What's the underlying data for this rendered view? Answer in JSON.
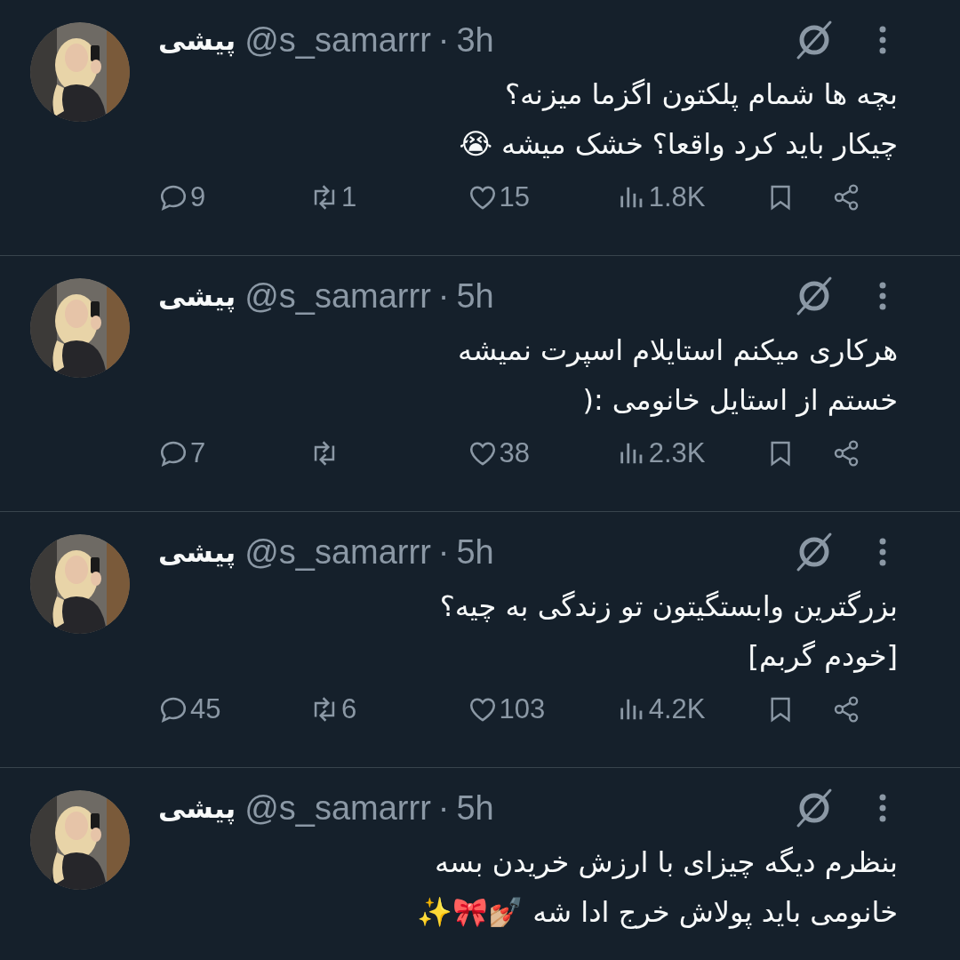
{
  "separator": "·",
  "tweets": [
    {
      "name": "پیشی",
      "handle": "@s_samarrr",
      "time": "3h",
      "lines": [
        "بچه ها شمام پلکتون اگزما میزنه؟",
        "چیکار باید کرد واقعا؟ خشک میشه 😭"
      ],
      "replies": "9",
      "reposts": "1",
      "likes": "15",
      "views": "1.8K"
    },
    {
      "name": "پیشی",
      "handle": "@s_samarrr",
      "time": "5h",
      "lines": [
        "هرکاری میکنم استایلام اسپرت نمیشه",
        "خستم از استایل خانومی :("
      ],
      "replies": "7",
      "likes": "38",
      "views": "2.3K"
    },
    {
      "name": "پیشی",
      "handle": "@s_samarrr",
      "time": "5h",
      "lines": [
        "بزرگترین وابستگیتون تو زندگی به چیه؟",
        "[خودم گربم]"
      ],
      "replies": "45",
      "reposts": "6",
      "likes": "103",
      "views": "4.2K"
    },
    {
      "name": "پیشی",
      "handle": "@s_samarrr",
      "time": "5h",
      "lines": [
        "بنظرم دیگه چیزای با ارزش خریدن بسه",
        "خانومی باید پولاش خرج ادا شه 💅🏼🎀✨"
      ]
    }
  ]
}
